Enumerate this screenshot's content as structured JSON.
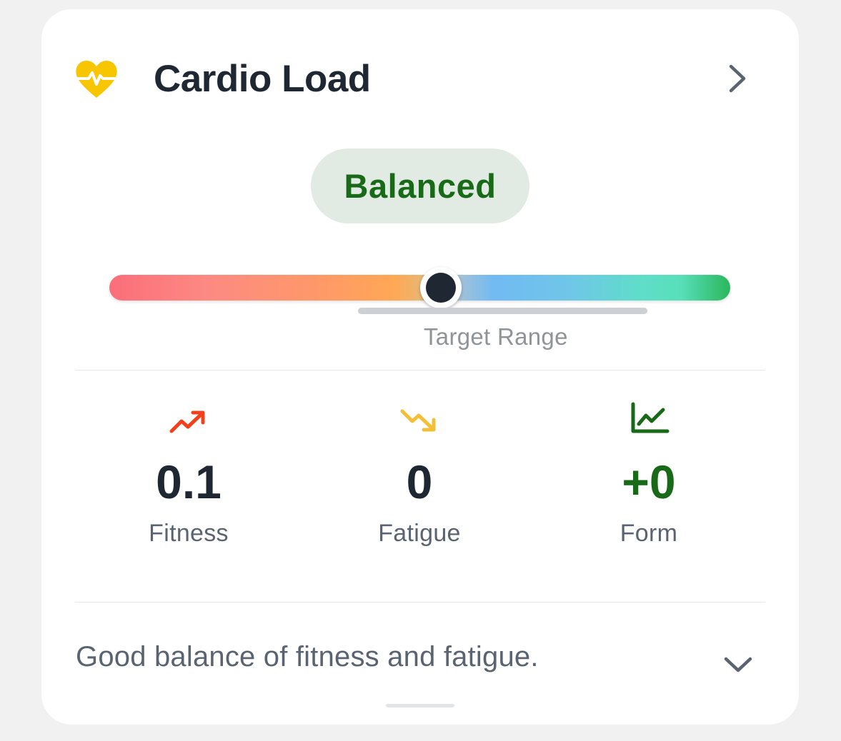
{
  "card": {
    "title": "Cardio Load",
    "icon": "heart-pulse-icon",
    "status": "Balanced",
    "target_label": "Target Range",
    "gauge_position": 0.54
  },
  "metrics": [
    {
      "value": "0.1",
      "label": "Fitness",
      "icon": "trending-up-icon",
      "color": "#f2401d"
    },
    {
      "value": "0",
      "label": "Fatigue",
      "icon": "trending-down-icon",
      "color": "#f2c038"
    },
    {
      "value": "+0",
      "label": "Form",
      "icon": "line-chart-icon",
      "color": "#196a18"
    }
  ],
  "summary": "Good balance of fitness and fatigue.",
  "colors": {
    "accent_green": "#196a18",
    "badge_bg": "#e2ebe3",
    "heart_yellow": "#f7c600",
    "text_dark": "#1f2733"
  }
}
